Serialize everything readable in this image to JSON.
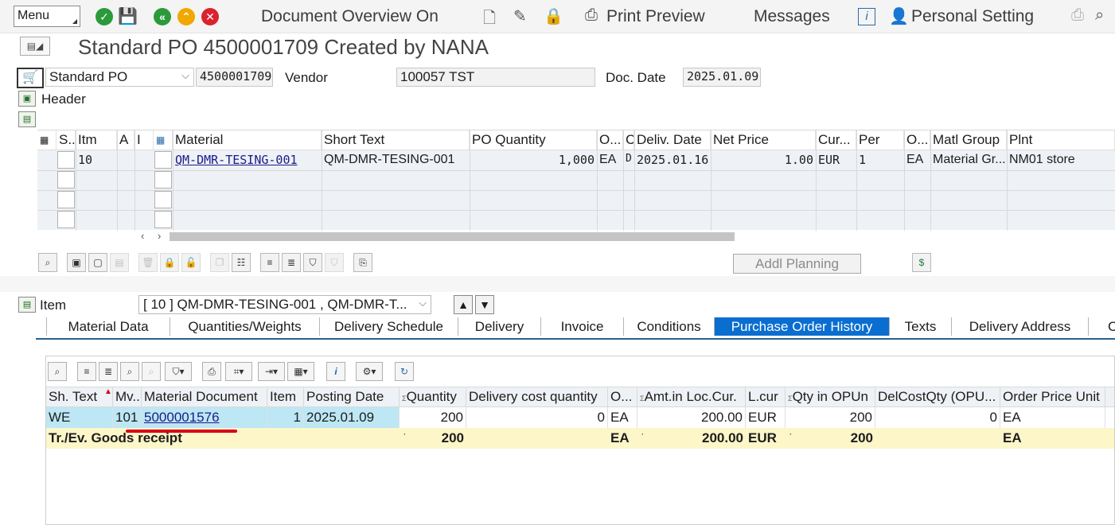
{
  "toolbar": {
    "menu_label": "Menu",
    "document_overview": "Document Overview On",
    "print_preview": "Print Preview",
    "messages": "Messages",
    "personal_setting": "Personal Setting"
  },
  "title": "Standard PO 4500001709 Created by NANA",
  "header": {
    "doc_type": "Standard PO",
    "po_number": "4500001709",
    "vendor_label": "Vendor",
    "vendor_value": "100057 TST",
    "doc_date_label": "Doc. Date",
    "doc_date_value": "2025.01.09",
    "section_label": "Header"
  },
  "items_grid": {
    "columns": [
      "S..",
      "Itm",
      "A",
      "I",
      "Material",
      "Short Text",
      "PO Quantity",
      "O...",
      "C",
      "Deliv. Date",
      "Net Price",
      "Cur...",
      "Per",
      "O...",
      "Matl Group",
      "Plnt"
    ],
    "rows": [
      {
        "itm": "10",
        "material": "QM-DMR-TESING-001",
        "short_text": "QM-DMR-TESING-001",
        "po_qty": "1,000",
        "uom": "EA",
        "c": "D",
        "deliv_date": "2025.01.16",
        "net_price": "1.00",
        "currency": "EUR",
        "per": "1",
        "order_unit": "EA",
        "matl_group": "Material Gr...",
        "plant": "NM01 store"
      }
    ]
  },
  "buttons": {
    "addl_planning": "Addl Planning"
  },
  "item_detail": {
    "item_label": "Item",
    "item_select": "[ 10 ] QM-DMR-TESING-001 , QM-DMR-T..."
  },
  "tabs": [
    {
      "label": "Material Data"
    },
    {
      "label": "Quantities/Weights"
    },
    {
      "label": "Delivery Schedule"
    },
    {
      "label": "Delivery"
    },
    {
      "label": "Invoice"
    },
    {
      "label": "Conditions"
    },
    {
      "label": "Purchase Order History"
    },
    {
      "label": "Texts"
    },
    {
      "label": "Delivery Address"
    },
    {
      "label": "C"
    }
  ],
  "history": {
    "columns": [
      "Sh. Text",
      "Mv...",
      "Material Document",
      "Item",
      "Posting Date",
      "Quantity",
      "Delivery cost quantity",
      "O...",
      "Amt.in Loc.Cur.",
      "L.cur",
      "Qty in OPUn",
      "DelCostQty (OPU...",
      "Order Price Unit"
    ],
    "row": {
      "sh_text": "WE",
      "mvt": "101",
      "mat_doc": "5000001576",
      "item": "1",
      "posting_date": "2025.01.09",
      "quantity": "200",
      "del_cost_qty": "0",
      "uom": "EA",
      "amount": "200.00",
      "lcur": "EUR",
      "qty_opun": "200",
      "delcost_opu": "0",
      "opu": "EA"
    },
    "summary": {
      "label": "Tr./Ev. Goods receipt",
      "quantity": "200",
      "uom": "EA",
      "amount": "200.00",
      "lcur": "EUR",
      "qty_opun": "200",
      "opu": "EA"
    }
  },
  "colors": {
    "accent": "#0a6ed1",
    "row_highlight": "#bde7f4",
    "summary_row": "#fdf6c8",
    "mark_red": "#d6001c"
  }
}
